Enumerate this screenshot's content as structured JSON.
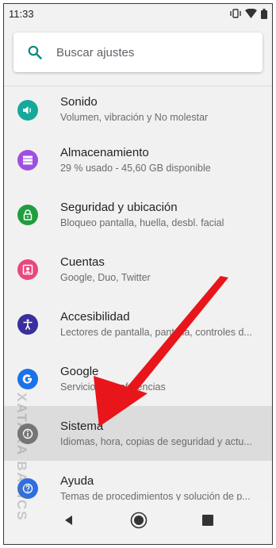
{
  "status_bar": {
    "time": "11:33",
    "icons": [
      "vibrate-icon",
      "wifi-icon",
      "battery-icon"
    ]
  },
  "search": {
    "placeholder": "Buscar ajustes",
    "icon": "search-icon",
    "accent": "#0b8a7a"
  },
  "settings": [
    {
      "title": "Sonido",
      "subtitle": "Volumen, vibración y No molestar",
      "icon": "volume-icon",
      "color": "#15a99c"
    },
    {
      "title": "Almacenamiento",
      "subtitle": "29 % usado - 45,60 GB disponible",
      "icon": "storage-icon",
      "color": "#9e4fe0"
    },
    {
      "title": "Seguridad y ubicación",
      "subtitle": "Bloqueo pantalla, huella, desbl. facial",
      "icon": "lock-icon",
      "color": "#1f9e3e"
    },
    {
      "title": "Cuentas",
      "subtitle": "Google, Duo, Twitter",
      "icon": "account-icon",
      "color": "#e8487c"
    },
    {
      "title": "Accesibilidad",
      "subtitle": "Lectores de pantalla, pantalla, controles d...",
      "icon": "accessibility-icon",
      "color": "#3b2e9e"
    },
    {
      "title": "Google",
      "subtitle": "Servicios y preferencias",
      "icon": "google-icon",
      "color": "#1a73e8"
    },
    {
      "title": "Sistema",
      "subtitle": "Idiomas, hora, copias de seguridad y actu...",
      "icon": "info-icon",
      "color": "#757575",
      "active": true
    },
    {
      "title": "Ayuda",
      "subtitle": "Temas de procedimientos y solución de p...",
      "icon": "help-icon",
      "color": "#2f6fe0"
    }
  ],
  "nav": {
    "buttons": [
      "back-icon",
      "home-icon",
      "recents-icon"
    ]
  },
  "annotation": {
    "arrow_color": "#e8151b",
    "watermark": "XATAKA BASICS"
  }
}
